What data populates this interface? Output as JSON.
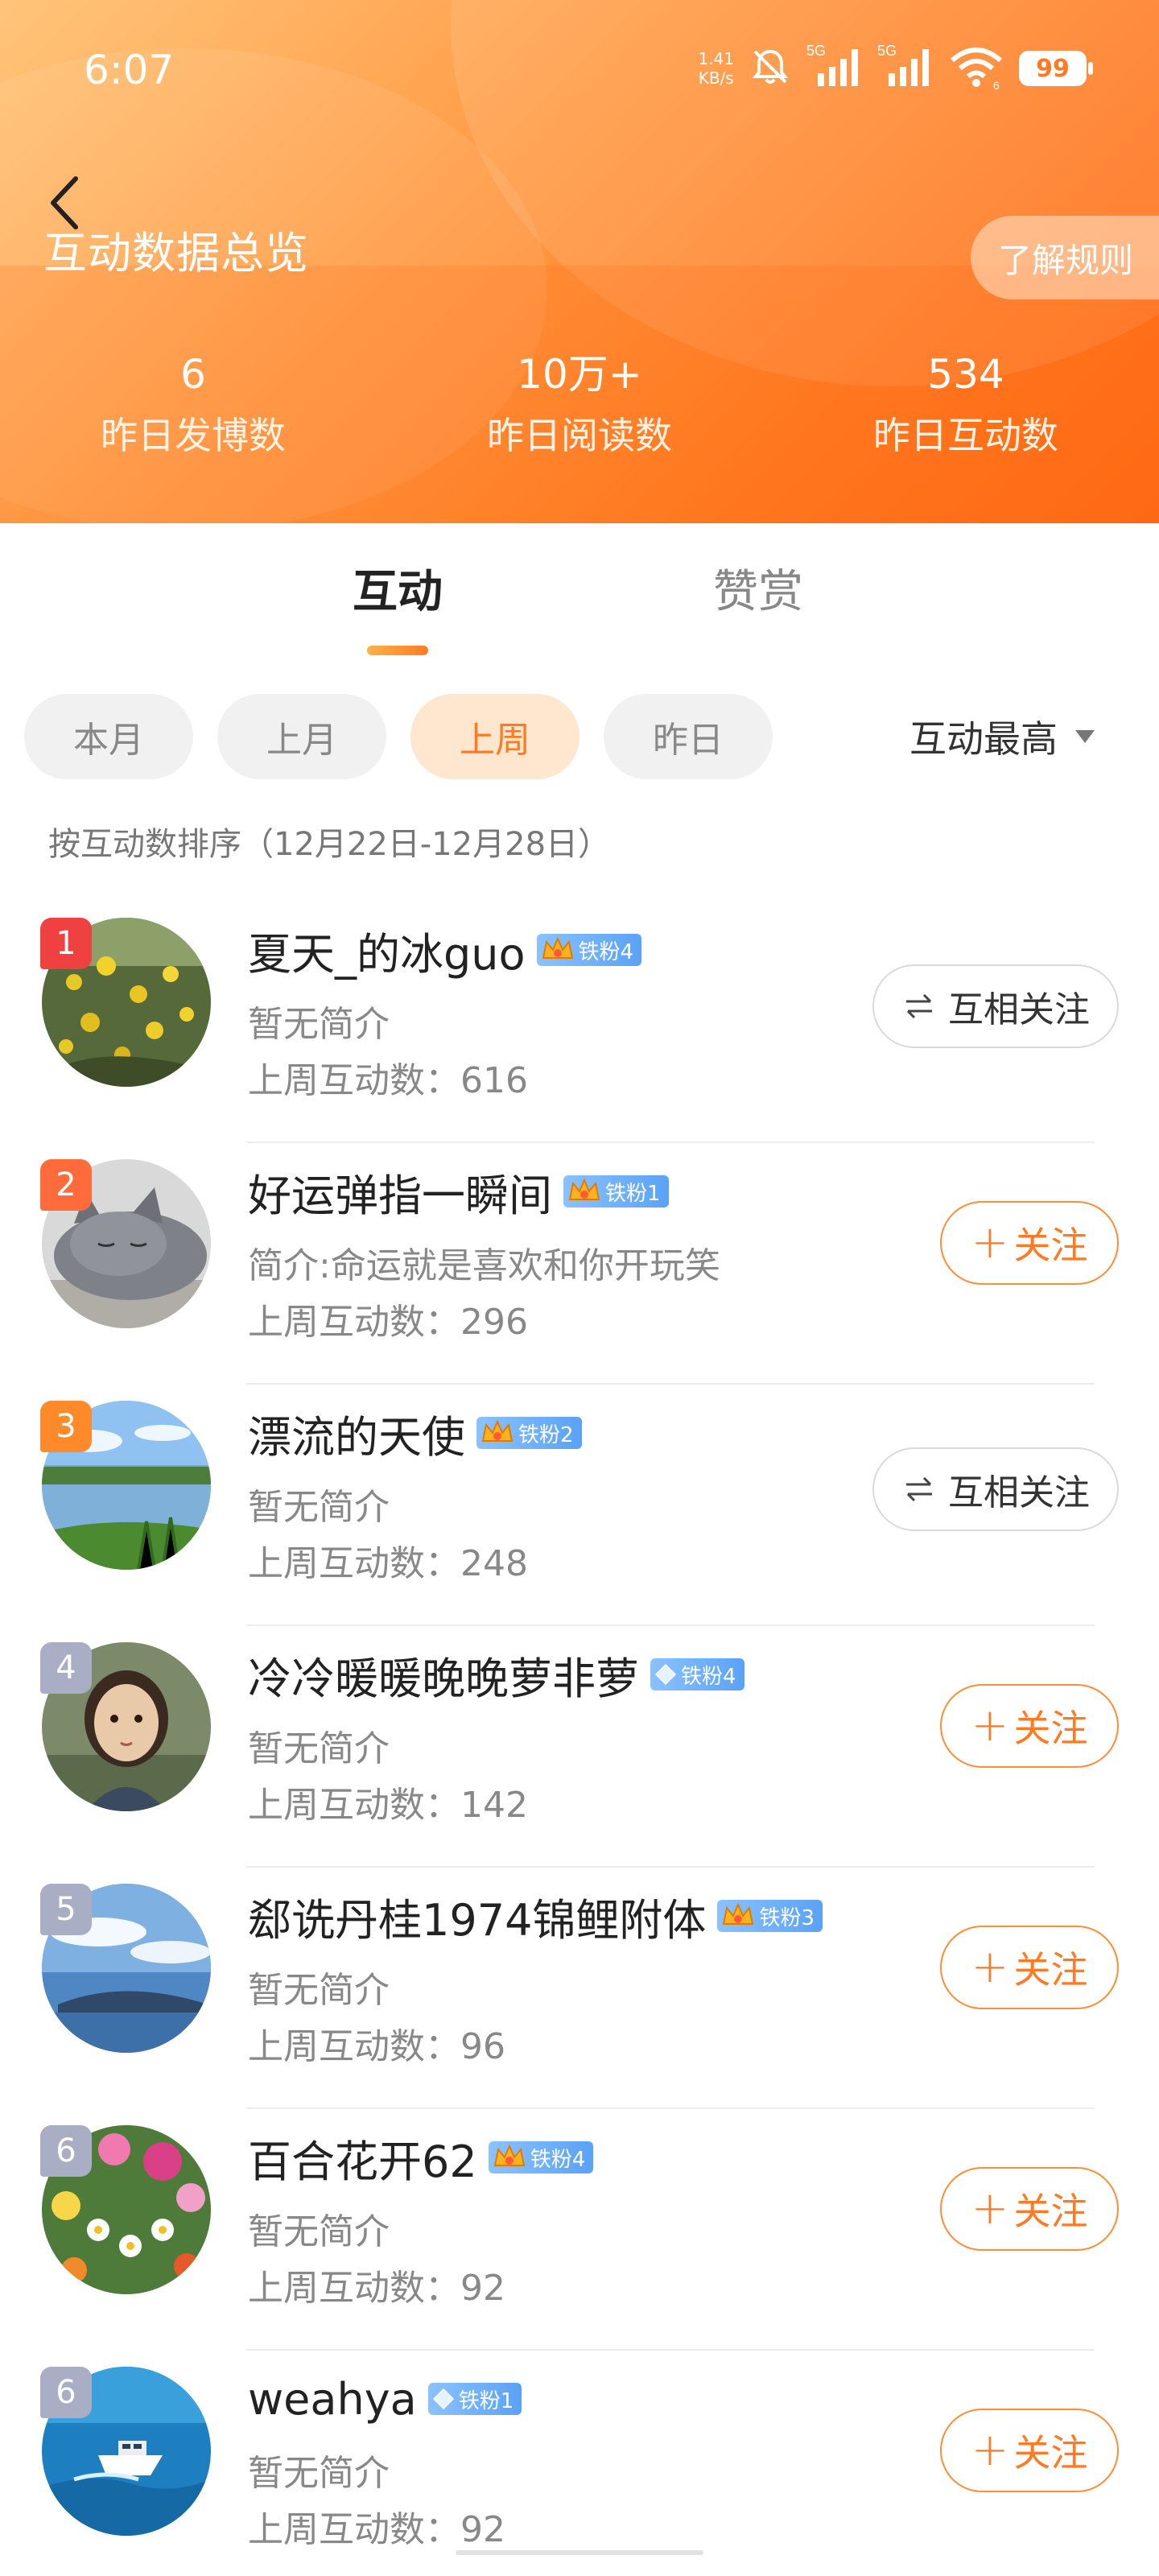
{
  "status_bar": {
    "time": "6:07",
    "net_speed_value": "1.41",
    "net_speed_unit": "KB/s",
    "signal_1": "5G",
    "signal_2": "5G",
    "wifi_sub": "6",
    "battery": "99",
    "icons": [
      "bell-muted-icon",
      "signal-icon",
      "signal-icon",
      "wifi-icon",
      "battery-icon"
    ]
  },
  "header": {
    "title": "互动数据总览",
    "rules_button": "了解规则",
    "back_icon": "chevron-left-icon",
    "stats": [
      {
        "value": "6",
        "label": "昨日发博数"
      },
      {
        "value": "10万+",
        "label": "昨日阅读数"
      },
      {
        "value": "534",
        "label": "昨日互动数"
      }
    ]
  },
  "tabs": [
    {
      "label": "互动",
      "active": true
    },
    {
      "label": "赞赏",
      "active": false
    }
  ],
  "filters": [
    {
      "label": "本月",
      "active": false
    },
    {
      "label": "上月",
      "active": false
    },
    {
      "label": "上周",
      "active": true
    },
    {
      "label": "昨日",
      "active": false
    }
  ],
  "sort": {
    "label": "互动最高",
    "icon": "caret-down-icon"
  },
  "sort_note": "按互动数排序（12月22日-12月28日）",
  "count_label": "上周互动数：",
  "buttons": {
    "mutual": "互相关注",
    "follow": "关注",
    "mutual_icon": "swap-arrows-icon",
    "follow_icon": "plus-icon"
  },
  "list": [
    {
      "rank": "1",
      "name": "夏天_的冰guo",
      "badge": "铁粉4",
      "badge_icon": "crown-icon",
      "intro": "暂无简介",
      "count": "616",
      "relation": "mutual",
      "avatar": "flowers-field"
    },
    {
      "rank": "2",
      "name": "好运弹指一瞬间",
      "badge": "铁粉1",
      "badge_icon": "crown-icon",
      "intro": "简介:命运就是喜欢和你开玩笑",
      "count": "296",
      "relation": "follow",
      "avatar": "sleeping-cat"
    },
    {
      "rank": "3",
      "name": "漂流的天使",
      "badge": "铁粉2",
      "badge_icon": "crown-icon",
      "intro": "暂无简介",
      "count": "248",
      "relation": "mutual",
      "avatar": "lake-landscape"
    },
    {
      "rank": "4",
      "name": "冷冷暖暖晚晚萝非萝",
      "badge": "铁粉4",
      "badge_icon": "diamond-icon",
      "intro": "暂无简介",
      "count": "142",
      "relation": "follow",
      "avatar": "painted-child"
    },
    {
      "rank": "5",
      "name": "郄诜丹桂1974锦鲤附体",
      "badge": "铁粉3",
      "badge_icon": "crown-icon",
      "intro": "暂无简介",
      "count": "96",
      "relation": "follow",
      "avatar": "sky-sea"
    },
    {
      "rank": "6",
      "name": "百合花开62",
      "badge": "铁粉4",
      "badge_icon": "crown-icon",
      "intro": "暂无简介",
      "count": "92",
      "relation": "follow",
      "avatar": "flower-garden"
    },
    {
      "rank": "6",
      "name": "weahya",
      "badge": "铁粉1",
      "badge_icon": "diamond-icon",
      "intro": "暂无简介",
      "count": "92",
      "relation": "follow",
      "avatar": "boat-sea"
    }
  ],
  "colors": {
    "accent": "#ff7a22",
    "rank_1": "#f04141",
    "rank_2": "#ff6b3a",
    "rank_3": "#ff8a2a",
    "rank_other": "#a9aec4",
    "badge_blue": "#5aa2f5"
  }
}
